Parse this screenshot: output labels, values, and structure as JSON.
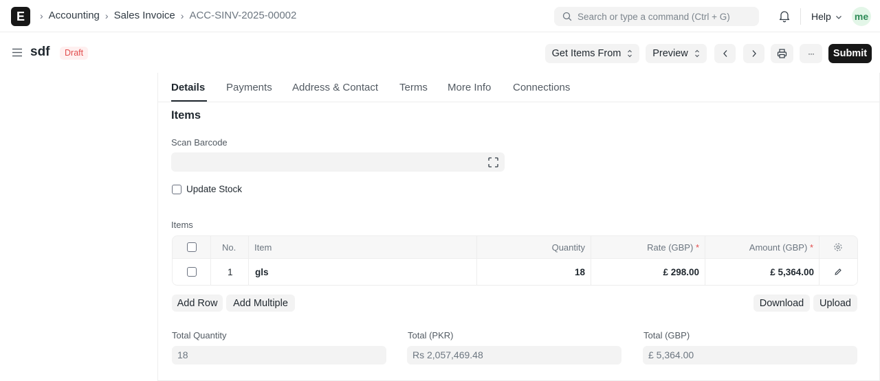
{
  "navbar": {
    "logo_letter": "E",
    "breadcrumbs": [
      "Accounting",
      "Sales Invoice",
      "ACC-SINV-2025-00002"
    ],
    "search_placeholder": "Search or type a command (Ctrl + G)",
    "help_label": "Help",
    "avatar_initials": "me"
  },
  "header": {
    "title": "sdf",
    "status_badge": "Draft",
    "get_items_label": "Get Items From",
    "preview_label": "Preview",
    "more_label": "···",
    "submit_label": "Submit"
  },
  "tabs": [
    "Details",
    "Payments",
    "Address & Contact",
    "Terms",
    "More Info",
    "Connections"
  ],
  "active_tab": "Details",
  "section": {
    "title": "Items",
    "scan_barcode_label": "Scan Barcode",
    "update_stock_label": "Update Stock",
    "items_table_label": "Items"
  },
  "items_table": {
    "columns": {
      "no": "No.",
      "item": "Item",
      "quantity": "Quantity",
      "rate": "Rate (GBP)",
      "amount": "Amount (GBP)"
    },
    "rows": [
      {
        "no": "1",
        "item": "gls",
        "quantity": "18",
        "rate": "£ 298.00",
        "amount": "£ 5,364.00"
      }
    ]
  },
  "table_actions": {
    "add_row": "Add Row",
    "add_multiple": "Add Multiple",
    "download": "Download",
    "upload": "Upload"
  },
  "totals": {
    "total_quantity_label": "Total Quantity",
    "total_quantity_value": "18",
    "total_pkr_label": "Total (PKR)",
    "total_pkr_value": "Rs 2,057,469.48",
    "total_gbp_label": "Total (GBP)",
    "total_gbp_value": "£ 5,364.00"
  },
  "colors": {
    "primary_button": "#171717",
    "draft_badge_bg": "#fff0f0",
    "draft_badge_text": "#e24c4c",
    "avatar_bg": "#e3f6e8"
  }
}
